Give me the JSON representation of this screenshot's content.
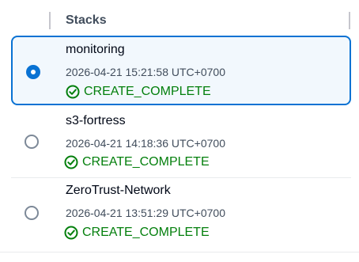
{
  "table": {
    "column_header": "Stacks",
    "rows": [
      {
        "name": "monitoring",
        "timestamp": "2026-04-21 15:21:58 UTC+0700",
        "status": "CREATE_COMPLETE",
        "selected": true
      },
      {
        "name": "s3-fortress",
        "timestamp": "2026-04-21 14:18:36 UTC+0700",
        "status": "CREATE_COMPLETE",
        "selected": false
      },
      {
        "name": "ZeroTrust-Network",
        "timestamp": "2026-04-21 13:51:29 UTC+0700",
        "status": "CREATE_COMPLETE",
        "selected": false
      }
    ]
  },
  "colors": {
    "accent": "#0972d3",
    "selected_background": "#f2f8fd",
    "status_success": "#037f0c"
  },
  "icons": {
    "status": "check-circle-icon",
    "selection": "radio-button"
  }
}
